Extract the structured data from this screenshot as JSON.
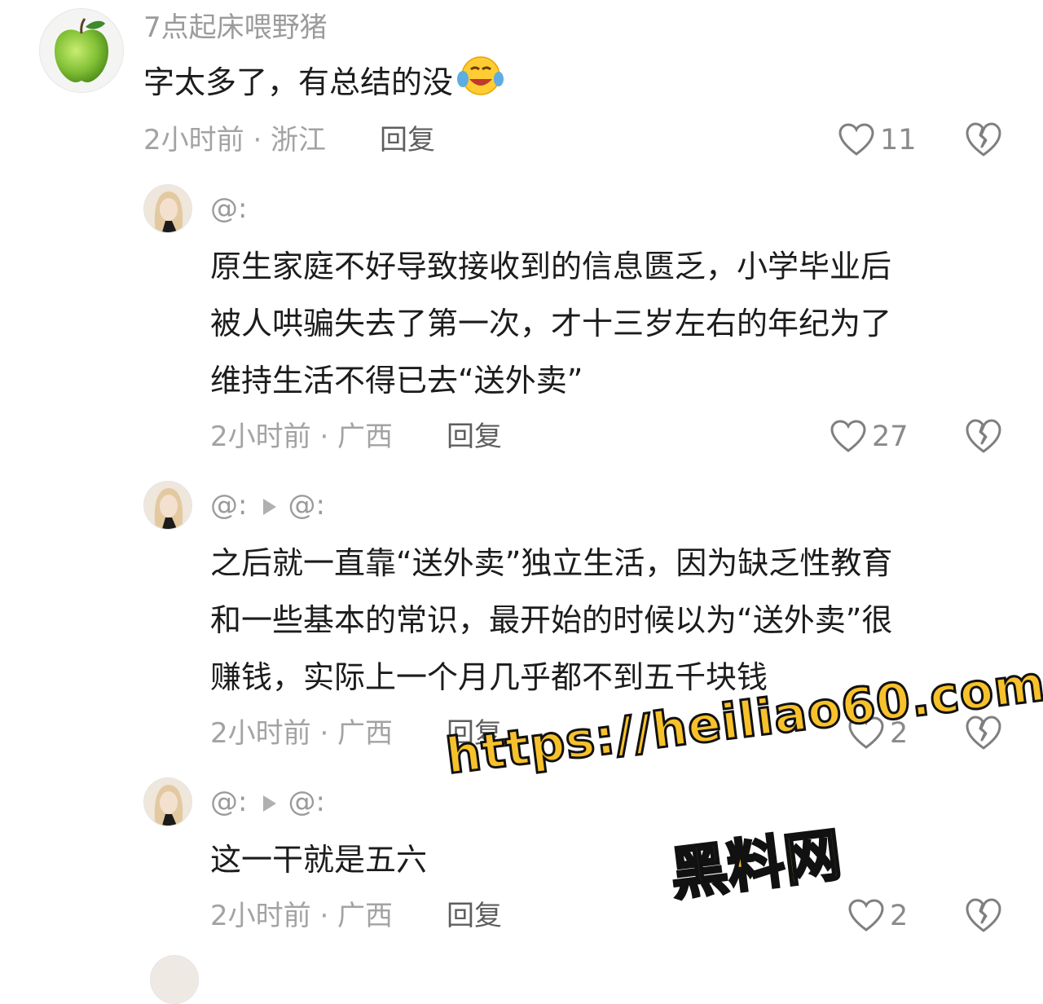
{
  "comments": [
    {
      "username": "7点起床喂野猪",
      "text": "字太多了，有总结的没",
      "time_location": "2小时前 · 浙江",
      "reply_label": "回复",
      "likes": "11"
    },
    {
      "username": "@:",
      "lines": [
        "原生家庭不好导致接收到的信息匮乏，小学毕业后",
        "被人哄骗失去了第一次，才十三岁左右的年纪为了",
        "维持生活不得已去“送外卖”"
      ],
      "time_location": "2小时前 · 广西",
      "reply_label": "回复",
      "likes": "27"
    },
    {
      "username": "@:",
      "reply_to": "@:",
      "lines": [
        "之后就一直靠“送外卖”独立生活，因为缺乏性教育",
        "和一些基本的常识，最开始的时候以为“送外卖”很",
        "赚钱，实际上一个月几乎都不到五千块钱"
      ],
      "time_location": "2小时前 · 广西",
      "reply_label": "回复",
      "likes": "2"
    },
    {
      "username": "@:",
      "reply_to": "@:",
      "lines": [
        "这一干就是五六"
      ],
      "time_location": "2小时前 · 广西",
      "reply_label": "回复",
      "likes": "2"
    }
  ],
  "watermark": {
    "url": "https://heiliao60.com",
    "name": "黑料网"
  },
  "icons": {
    "avatar_main": "green-apple",
    "like": "heart-outline-icon",
    "dislike": "broken-heart-icon",
    "emoji": "laughing-crying-emoji",
    "reply_arrow": "play-arrow-icon"
  },
  "colors": {
    "username": "#9b9b9b",
    "meta": "#a3a3a3",
    "watermark_fill": "#f7c12b",
    "apple": "#8cc63f"
  }
}
